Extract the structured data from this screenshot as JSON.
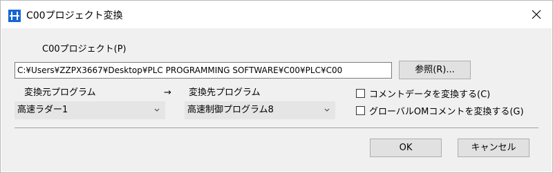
{
  "window": {
    "title": "C00プロジェクト変換",
    "close_glyph": "✕",
    "app_icon": "grid-app-icon"
  },
  "project": {
    "label": "C00プロジェクト(P)",
    "path_value": "C:¥Users¥ZZPX3667¥Desktop¥PLC PROGRAMMING SOFTWARE¥C00¥PLC¥C00",
    "browse_label": "参照(R)..."
  },
  "conversion": {
    "source_label": "変換元プログラム",
    "arrow": "→",
    "target_label": "変換先プログラム",
    "source_value": "高速ラダー1",
    "target_value": "高速制御プログラム8"
  },
  "options": {
    "convert_comment_label": "コメントデータを変換する(C)",
    "convert_comment_checked": false,
    "convert_global_label": "グローバルOMコメントを変換する(G)",
    "convert_global_checked": false
  },
  "actions": {
    "ok_label": "OK",
    "cancel_label": "キャンセル"
  }
}
